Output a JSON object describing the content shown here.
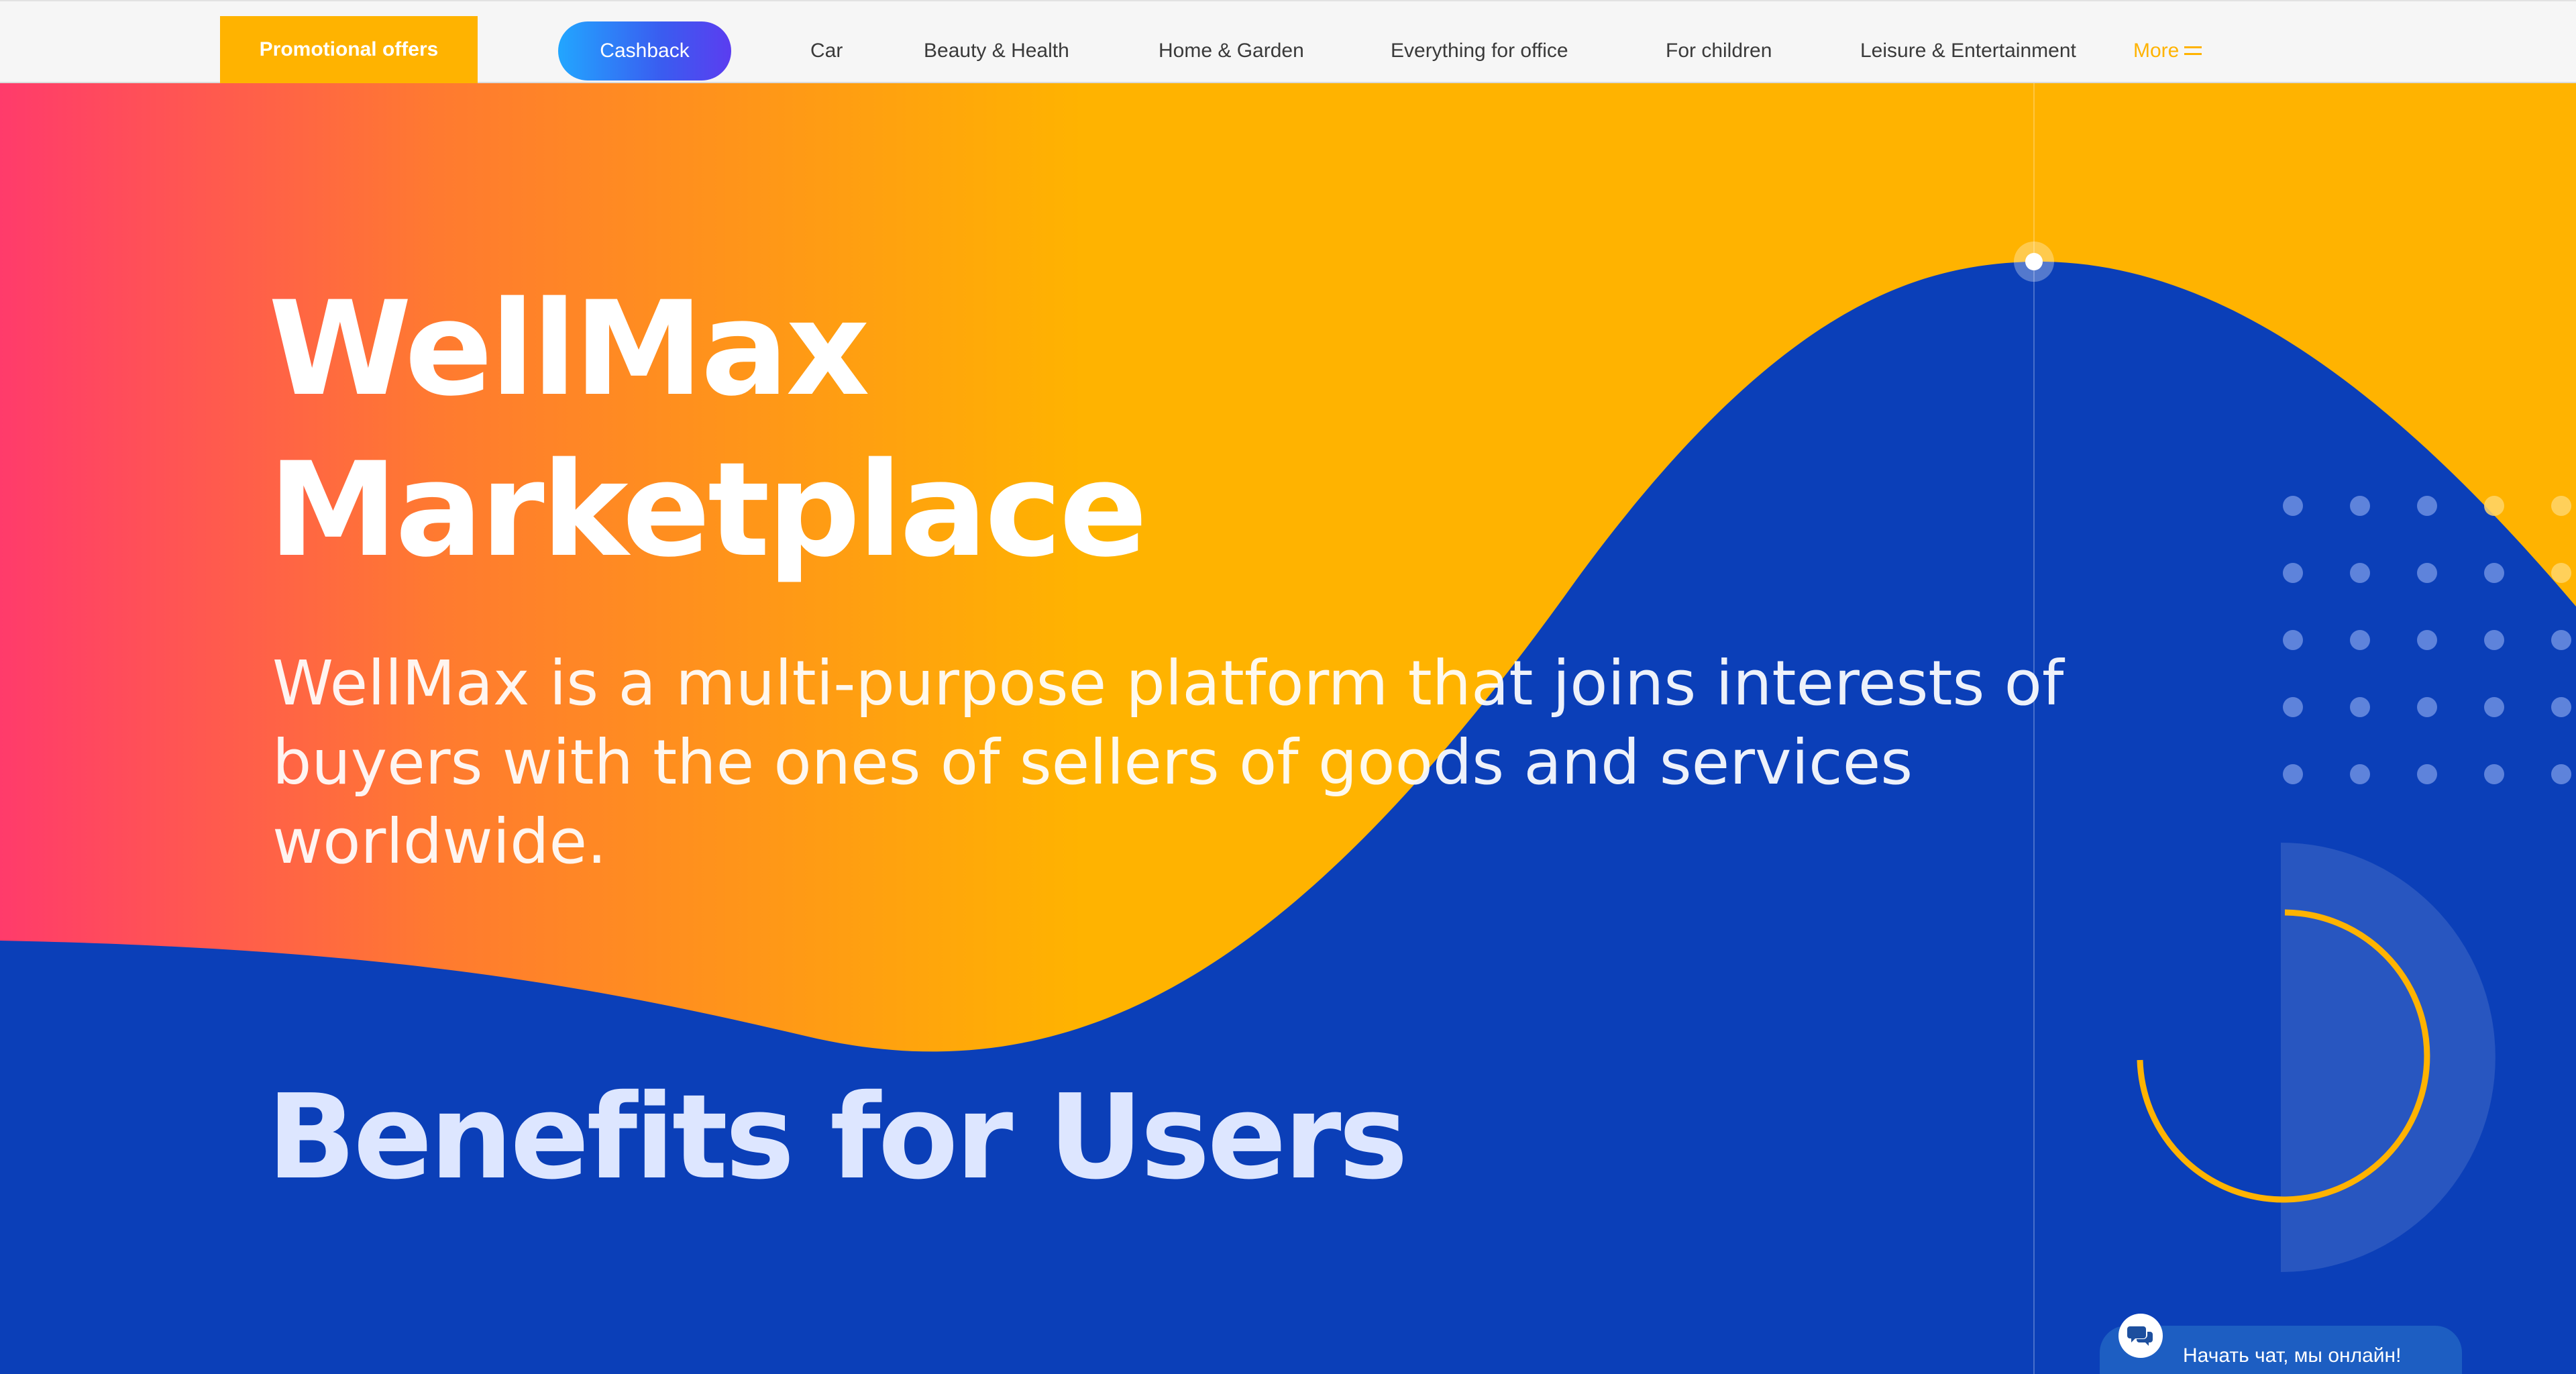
{
  "nav": {
    "promo_label": "Promotional offers",
    "cashback_label": "Cashback",
    "links": [
      "Car",
      "Beauty & Health",
      "Home & Garden",
      "Everything for office",
      "For children",
      "Leisure & Entertainment"
    ],
    "more_label": "More",
    "more_icon": "menu-icon"
  },
  "hero": {
    "title_line1": "WellMax",
    "title_line2": "Marketplace",
    "description": "WellMax is a multi-purpose platform that joins interests of buyers with the ones of sellers of goods and services worldwide."
  },
  "benefits": {
    "title": "Benefits for Users"
  },
  "chat": {
    "label": "Начать чат, мы онлайн!",
    "icon": "chat-bubbles-icon"
  },
  "colors": {
    "gradient_start": "#ff3b6b",
    "gradient_mid": "#ff8a25",
    "gradient_end": "#ffb300",
    "wave_blue": "#0b3fb8",
    "accent_yellow": "#ffb300",
    "cashback_start": "#22a6ff",
    "cashback_end": "#5b3df0"
  }
}
